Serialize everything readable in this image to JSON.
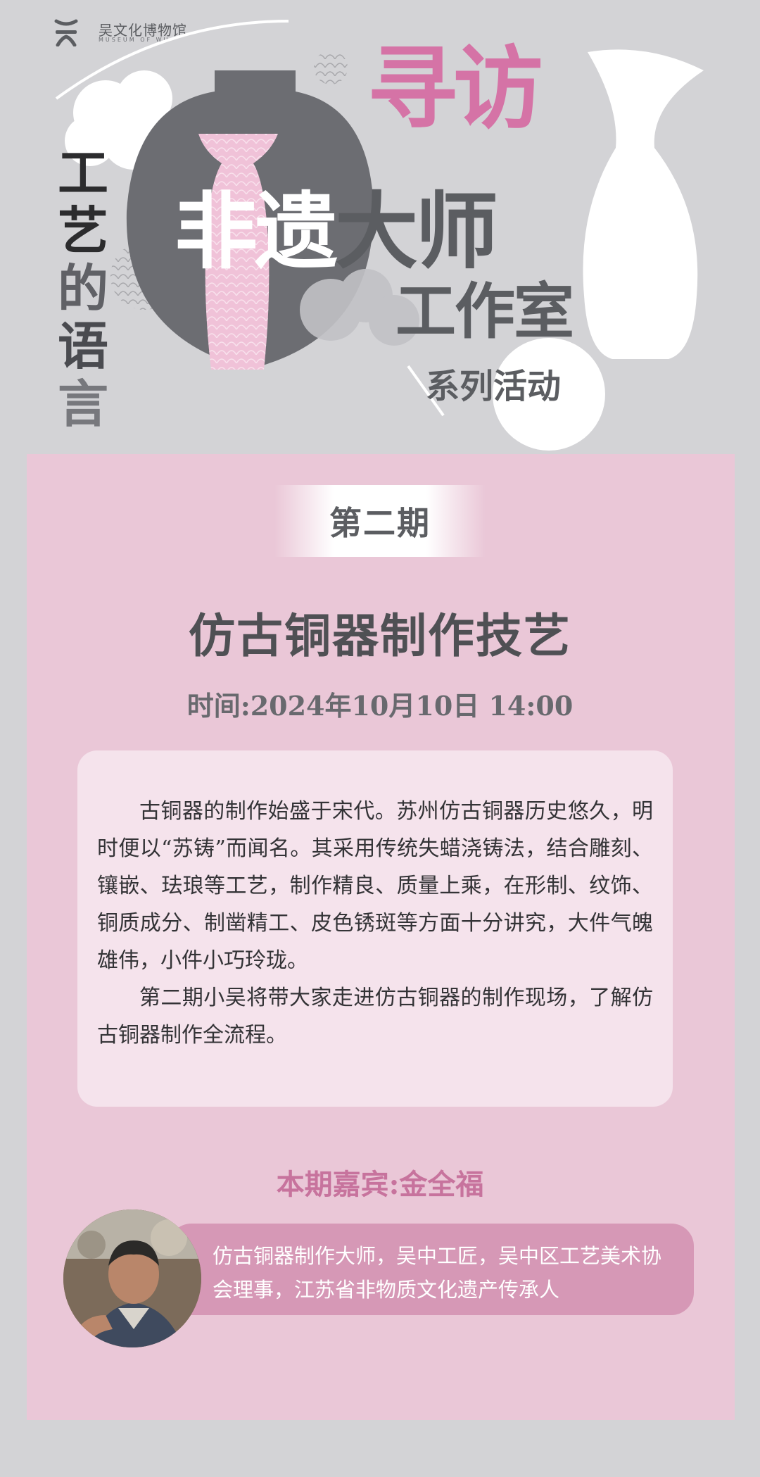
{
  "header": {
    "logo_cn": "吴文化博物馆",
    "logo_en": "MUSEUM OF WU",
    "vertical_title": [
      "工",
      "艺",
      "的",
      "语",
      "言"
    ],
    "title_xunfang": "寻访",
    "title_feiyi_1": "非遗",
    "title_feiyi_2": "大师",
    "title_studio": "工作室",
    "title_series": "系列活动"
  },
  "event": {
    "issue": "第二期",
    "title": "仿古铜器制作技艺",
    "time": "时间:2024年10月10日 14:00"
  },
  "description": {
    "paragraphs": [
      "古铜器的制作始盛于宋代。苏州仿古铜器历史悠久，明时便以“苏铸”而闻名。其采用传统失蜡浇铸法，结合雕刻、镶嵌、珐琅等工艺，制作精良、质量上乘，在形制、纹饰、铜质成分、制凿精工、皮色锈斑等方面十分讲究，大件气魄雄伟，小件小巧玲珑。",
      "第二期小吴将带大家走进仿古铜器的制作现场，了解仿古铜器制作全流程。"
    ]
  },
  "guest": {
    "label": "本期嘉宾:金全福",
    "bio": "仿古铜器制作大师，吴中工匠，吴中区工艺美术协会理事，江苏省非物质文化遗产传承人"
  },
  "colors": {
    "background": "#d3d3d6",
    "card_pink": "#eac7d7",
    "accent_pink": "#d573a6",
    "dark_grey": "#5b5d61",
    "guest_bar": "#d698b6"
  }
}
